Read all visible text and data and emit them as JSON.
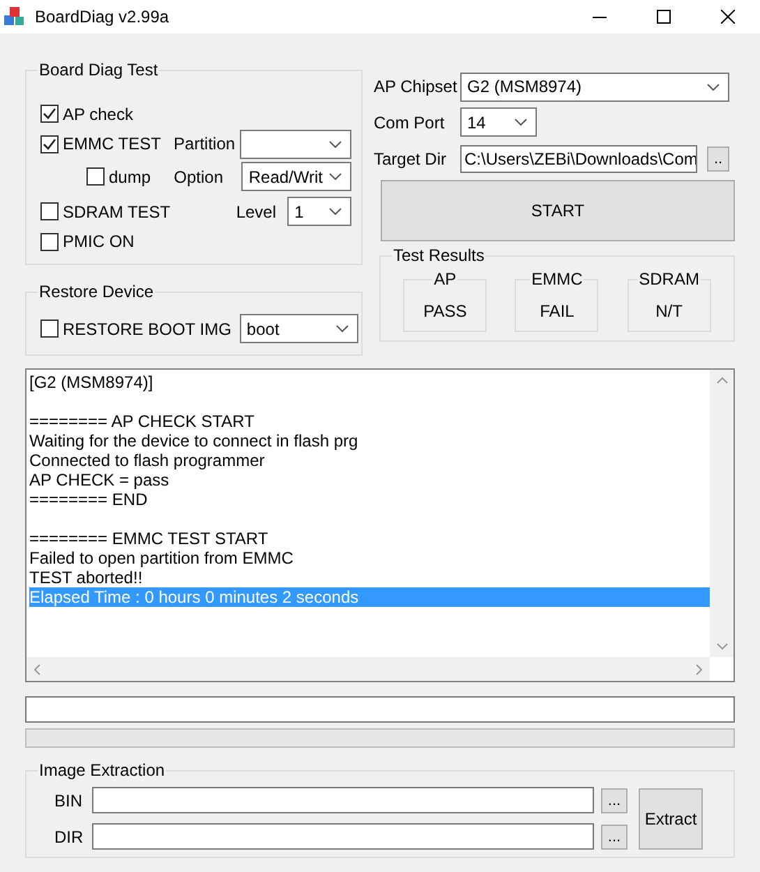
{
  "window": {
    "title": "BoardDiag v2.99a"
  },
  "board_diag_test": {
    "title": "Board Diag Test",
    "ap_check": {
      "label": "AP check",
      "checked": true
    },
    "emmc_test": {
      "label": "EMMC TEST",
      "checked": true
    },
    "partition": {
      "label": "Partition"
    },
    "dump": {
      "label": "dump",
      "checked": false
    },
    "option": {
      "label": "Option",
      "value": "Read/Writ"
    },
    "sdram_test": {
      "label": "SDRAM TEST",
      "checked": false
    },
    "level": {
      "label": "Level",
      "value": "1"
    },
    "pmic_on": {
      "label": "PMIC ON",
      "checked": false
    }
  },
  "restore_device": {
    "title": "Restore Device",
    "restore_boot_img": {
      "label": "RESTORE BOOT IMG",
      "checked": false
    },
    "image": {
      "value": "boot"
    }
  },
  "ap_chipset": {
    "label": "AP Chipset",
    "value": "G2 (MSM8974)"
  },
  "com_port": {
    "label": "Com Port",
    "value": "14"
  },
  "target_dir": {
    "label": "Target Dir",
    "value": "C:\\Users\\ZEBi\\Downloads\\Com",
    "browse": ".."
  },
  "start_button": "START",
  "test_results": {
    "title": "Test Results",
    "items": [
      {
        "name": "AP",
        "result": "PASS"
      },
      {
        "name": "EMMC",
        "result": "FAIL"
      },
      {
        "name": "SDRAM",
        "result": "N/T"
      }
    ]
  },
  "log": {
    "blocks": [
      {
        "lines": [
          {
            "text": "[G2 (MSM8974)]",
            "selected": false
          }
        ]
      },
      {
        "lines": [
          {
            "text": "======== AP CHECK START",
            "selected": false
          },
          {
            "text": "Waiting for the device to connect in flash prg",
            "selected": false
          },
          {
            "text": "Connected to flash programmer",
            "selected": false
          },
          {
            "text": "AP CHECK = pass",
            "selected": false
          },
          {
            "text": "======== END",
            "selected": false
          }
        ]
      },
      {
        "lines": [
          {
            "text": "======== EMMC TEST START",
            "selected": false
          },
          {
            "text": "Failed to open partition from EMMC",
            "selected": false
          },
          {
            "text": "TEST aborted!!",
            "selected": false
          },
          {
            "text": "Elapsed Time : 0 hours 0 minutes 2 seconds",
            "selected": true
          }
        ]
      }
    ]
  },
  "image_extraction": {
    "title": "Image Extraction",
    "bin": {
      "label": "BIN",
      "browse": "..."
    },
    "dir": {
      "label": "DIR",
      "browse": "..."
    },
    "extract_button": "Extract"
  }
}
